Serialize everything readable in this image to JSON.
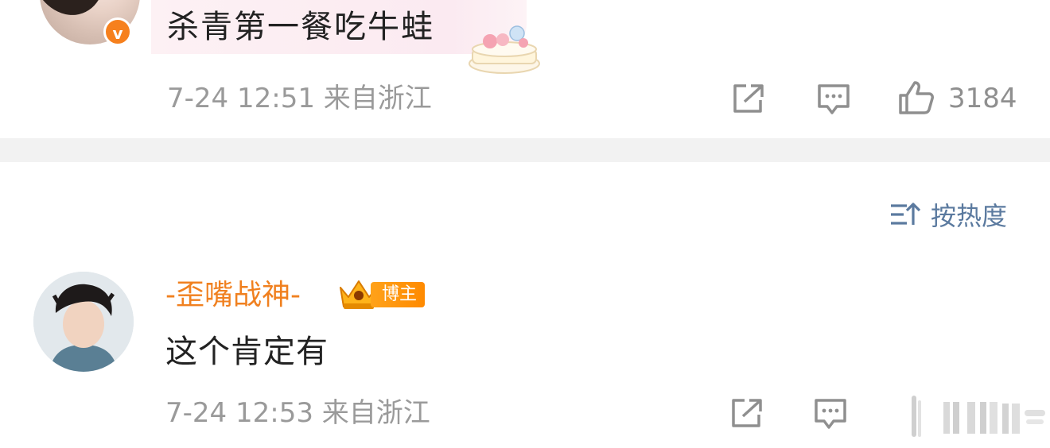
{
  "post": {
    "text": "杀青第一餐吃牛蛙",
    "verified_badge": "v",
    "meta": "7-24 12:51 来自浙江",
    "like_count": "3184"
  },
  "sort": {
    "label": "按热度"
  },
  "comment": {
    "username": "-歪嘴战神-",
    "role_badge": "博主",
    "text": "这个肯定有",
    "meta": "7-24 12:53 来自浙江"
  },
  "icons": {
    "share": "share-icon",
    "comment": "comment-icon",
    "like": "thumbs-up-icon",
    "sort": "sort-icon",
    "crown": "crown-icon"
  },
  "colors": {
    "username": "#f0801f",
    "badge": "#ff9500",
    "sort": "#5b7a9f",
    "meta": "#9a9a9a"
  }
}
